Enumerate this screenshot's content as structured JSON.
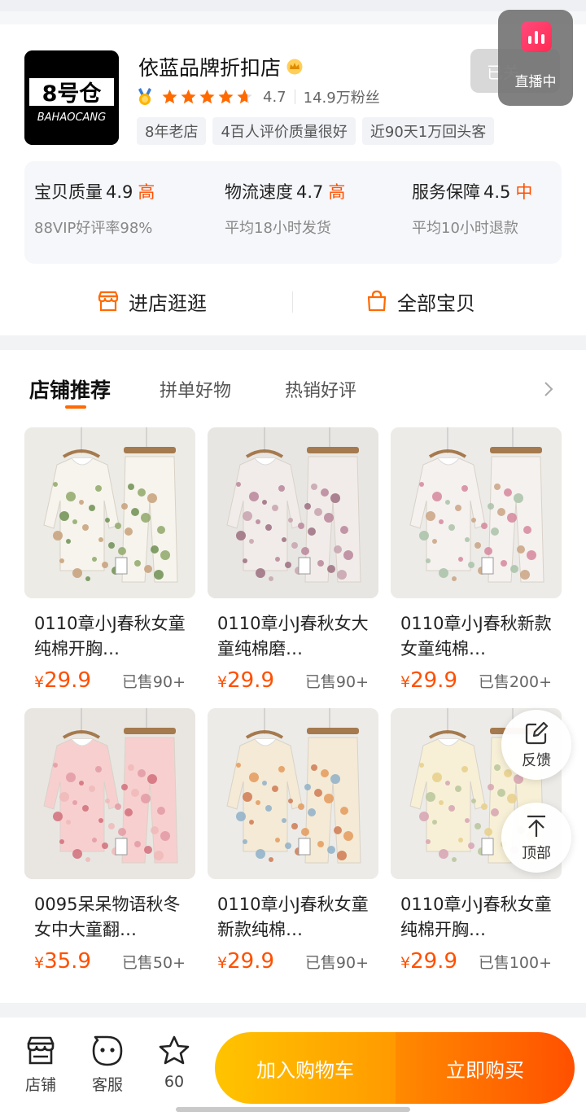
{
  "store": {
    "logo_text_top": "8号仓",
    "logo_text_bottom": "BAHAOCANG",
    "name": "依蓝品牌折扣店",
    "rating": "4.7",
    "rating_value": 4.7,
    "fans": "14.9万粉丝",
    "tags": [
      "8年老店",
      "4百人评价质量很好",
      "近90天1万回头客"
    ],
    "follow_label": "已关",
    "live_label": "直播中"
  },
  "scores": [
    {
      "title": "宝贝质量",
      "num": "4.9",
      "level": "高",
      "sub": "88VIP好评率98%"
    },
    {
      "title": "物流速度",
      "num": "4.7",
      "level": "高",
      "sub": "平均18小时发货"
    },
    {
      "title": "服务保障",
      "num": "4.5",
      "level": "中",
      "sub": "平均10小时退款"
    }
  ],
  "actions": {
    "enter_store": "进店逛逛",
    "all_items": "全部宝贝"
  },
  "tabs": [
    "店铺推荐",
    "拼单好物",
    "热销好评"
  ],
  "products": [
    {
      "title": "0110章小J春秋女童纯棉开胸…",
      "currency": "¥",
      "price": "29.9",
      "sold": "已售90+",
      "palette": "green"
    },
    {
      "title": "0110章小J春秋女大童纯棉磨…",
      "currency": "¥",
      "price": "29.9",
      "sold": "已售90+",
      "palette": "mauve"
    },
    {
      "title": "0110章小J春秋新款女童纯棉…",
      "currency": "¥",
      "price": "29.9",
      "sold": "已售200+",
      "palette": "rose"
    },
    {
      "title": "0095呆呆物语秋冬女中大童翻…",
      "currency": "¥",
      "price": "35.9",
      "sold": "已售50+",
      "palette": "pink"
    },
    {
      "title": "0110章小J春秋女童新款纯棉…",
      "currency": "¥",
      "price": "29.9",
      "sold": "已售90+",
      "palette": "orange"
    },
    {
      "title": "0110章小J春秋女童纯棉开胸…",
      "currency": "¥",
      "price": "29.9",
      "sold": "已售100+",
      "palette": "yellow"
    }
  ],
  "float": {
    "feedback": "反馈",
    "top": "顶部"
  },
  "bottom": {
    "store": "店铺",
    "service": "客服",
    "fav_count": "60",
    "add_cart": "加入购物车",
    "buy_now": "立即购买"
  },
  "colors": {
    "accent": "#ff5000",
    "gold": "#ffb400",
    "cart_gradient": [
      "#ffc400",
      "#ff9a00"
    ],
    "buy_gradient": [
      "#ff8a00",
      "#ff5000"
    ]
  },
  "icons": [
    "crown-icon",
    "medal-icon",
    "star-icon",
    "shop-icon",
    "bag-icon",
    "chevron-right-icon",
    "edit-icon",
    "arrow-up-icon",
    "store-icon",
    "service-icon",
    "star-outline-icon",
    "live-icon"
  ]
}
